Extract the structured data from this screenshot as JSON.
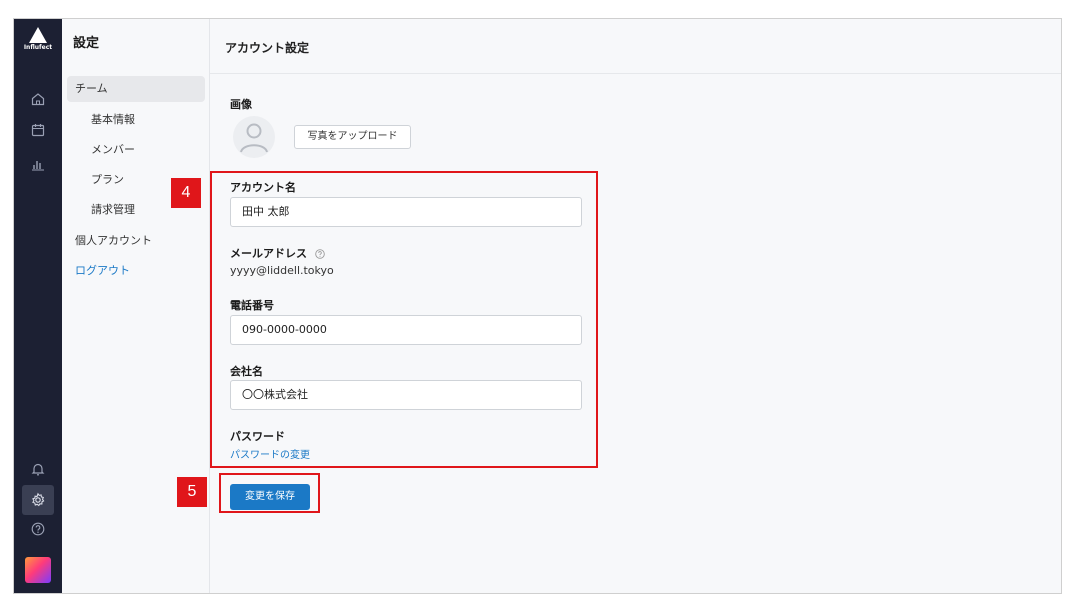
{
  "brand": {
    "logo_text": "Influfect"
  },
  "rail": {
    "icons": [
      "home-icon",
      "calendar-icon",
      "chart-icon",
      "bell-icon",
      "gear-icon",
      "help-icon"
    ]
  },
  "subnav": {
    "title": "設定",
    "items": [
      {
        "label": "チーム"
      },
      {
        "label": "基本情報"
      },
      {
        "label": "メンバー"
      },
      {
        "label": "プラン"
      },
      {
        "label": "請求管理"
      },
      {
        "label": "個人アカウント"
      },
      {
        "label": "ログアウト"
      }
    ]
  },
  "header": {
    "title": "アカウント設定"
  },
  "form": {
    "image_label": "画像",
    "upload_label": "写真をアップロード",
    "account_name_label": "アカウント名",
    "account_name_value": "田中 太郎",
    "email_label": "メールアドレス",
    "email_value": "yyyy@liddell.tokyo",
    "phone_label": "電話番号",
    "phone_value": "090-0000-0000",
    "company_label": "会社名",
    "company_value": "〇〇株式会社",
    "password_label": "パスワード",
    "password_link": "パスワードの変更",
    "save_label": "変更を保存"
  },
  "annotations": {
    "box4": "4",
    "box5": "5"
  },
  "colors": {
    "rail": "#1c2033",
    "accent": "#1b79c6",
    "highlight": "#e0161a"
  }
}
